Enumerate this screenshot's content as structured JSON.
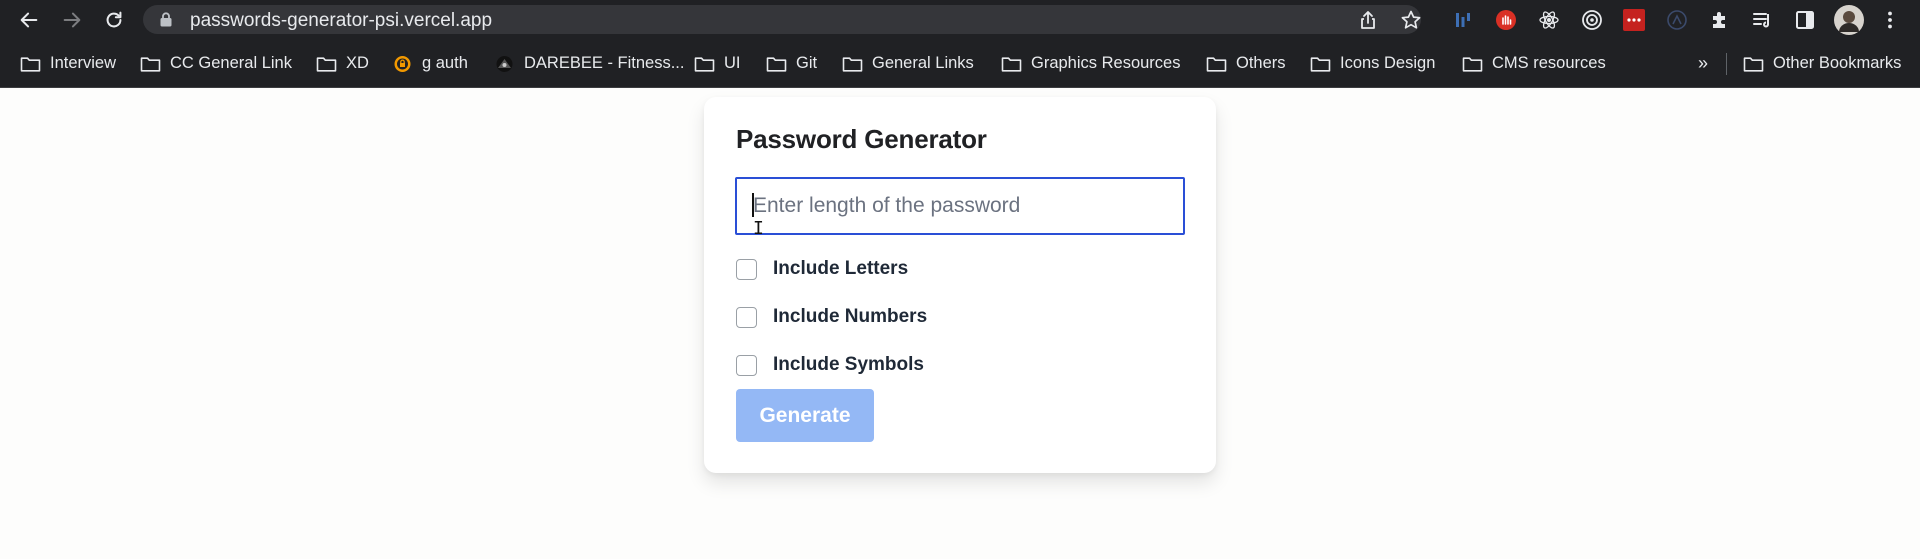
{
  "browser": {
    "url": "passwords-generator-psi.vercel.app",
    "bookmarks": [
      {
        "label": "Interview",
        "icon": "folder-icon"
      },
      {
        "label": "CC General Link",
        "icon": "folder-icon"
      },
      {
        "label": "XD",
        "icon": "folder-icon"
      },
      {
        "label": "g auth",
        "icon": "authenticator-icon"
      },
      {
        "label": "DAREBEE - Fitness...",
        "icon": "darebee-icon"
      },
      {
        "label": "UI",
        "icon": "folder-icon"
      },
      {
        "label": "Git",
        "icon": "folder-icon"
      },
      {
        "label": "General Links",
        "icon": "folder-icon"
      },
      {
        "label": "Graphics Resources",
        "icon": "folder-icon"
      },
      {
        "label": "Others",
        "icon": "folder-icon"
      },
      {
        "label": "Icons Design",
        "icon": "folder-icon"
      },
      {
        "label": "CMS resources",
        "icon": "folder-icon"
      }
    ],
    "overflow_label": "»",
    "other_bookmarks": "Other Bookmarks"
  },
  "app": {
    "title": "Password Generator",
    "length_placeholder": "Enter length of the password",
    "options": [
      {
        "label": "Include Letters",
        "checked": false
      },
      {
        "label": "Include Numbers",
        "checked": false
      },
      {
        "label": "Include Symbols",
        "checked": false
      }
    ],
    "generate_label": "Generate",
    "colors": {
      "accent_border": "#2a4fd6",
      "button_disabled": "#94b8f5"
    }
  }
}
